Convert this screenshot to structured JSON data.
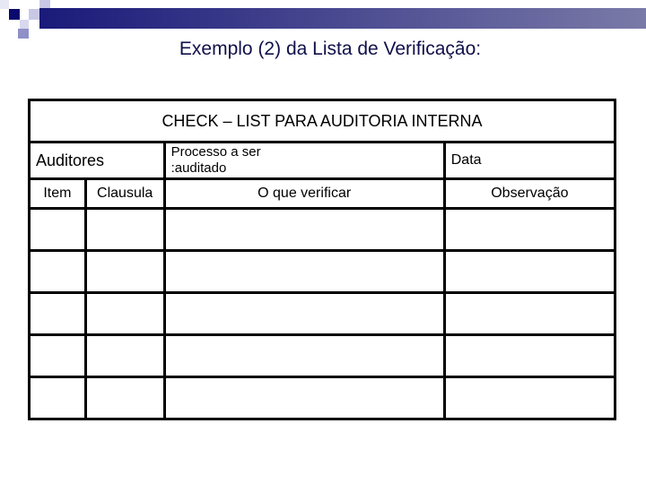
{
  "slide": {
    "title": "Exemplo (2) da Lista de Verificação:"
  },
  "checklist": {
    "heading": "CHECK – LIST PARA AUDITORIA INTERNA",
    "info_row": {
      "auditors_label": "Auditores",
      "process_label_line1": "Processo a ser",
      "process_label_line2": ":auditado",
      "date_label": "Data"
    },
    "columns": [
      "Item",
      "Clausula",
      "O que verificar",
      "Observação"
    ],
    "rows": [
      [
        "",
        "",
        "",
        ""
      ],
      [
        "",
        "",
        "",
        ""
      ],
      [
        "",
        "",
        "",
        ""
      ],
      [
        "",
        "",
        "",
        ""
      ],
      [
        "",
        "",
        "",
        ""
      ]
    ]
  },
  "colors": {
    "title_text": "#10104a",
    "header_bar_start": "#1a1a7a",
    "header_bar_end": "#7a7aa8"
  }
}
